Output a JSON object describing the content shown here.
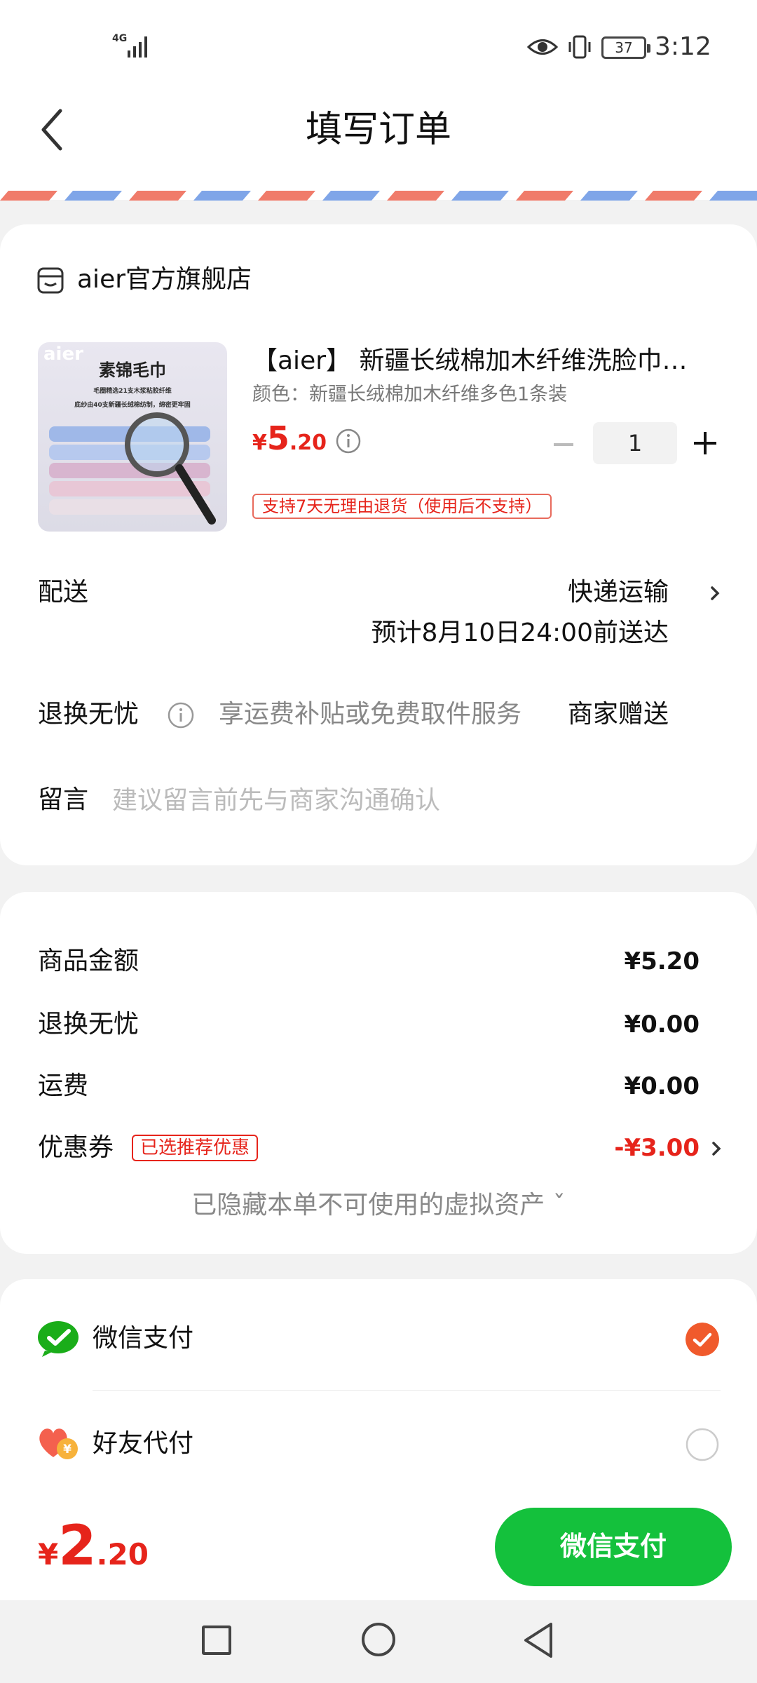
{
  "status_bar": {
    "network": "4G",
    "battery": "37",
    "time": "3:12"
  },
  "header": {
    "title": "填写订单"
  },
  "shop": {
    "name": "aier官方旗舰店"
  },
  "product": {
    "thumb_logo": "aier",
    "thumb_title": "素锦毛巾",
    "thumb_line1": "毛圈精选21支木浆粘胶纤维",
    "thumb_line2": "底纱由40支新疆长绒棉纺制，绵密更牢固",
    "title": "【aier】 新疆长绒棉加木纤维洗脸巾…",
    "spec": "颜色：新疆长绒棉加木纤维多色1条装",
    "price_currency": "¥",
    "price_int": "5",
    "price_dec": ".20",
    "quantity": "1",
    "return_tag": "支持7天无理由退货（使用后不支持）"
  },
  "delivery": {
    "label": "配送",
    "method": "快递运输",
    "eta": "预计8月10日24:00前送达"
  },
  "exchange": {
    "label": "退换无忧",
    "desc": "享运费补贴或免费取件服务",
    "value": "商家赠送"
  },
  "note": {
    "label": "留言",
    "placeholder": "建议留言前先与商家沟通确认"
  },
  "summary": {
    "goods_label": "商品金额",
    "goods_value": "¥5.20",
    "exchange_label": "退换无忧",
    "exchange_value": "¥0.00",
    "shipping_label": "运费",
    "shipping_value": "¥0.00",
    "coupon_label": "优惠券",
    "coupon_tag": "已选推荐优惠",
    "coupon_value": "-¥3.00",
    "hidden_assets": "已隐藏本单不可使用的虚拟资产 ˇ"
  },
  "payment": {
    "options": [
      {
        "label": "微信支付",
        "selected": true
      },
      {
        "label": "好友代付",
        "selected": false
      }
    ]
  },
  "bottom": {
    "total_currency": "¥",
    "total_int": "2",
    "total_dec": ".20",
    "pay_button": "微信支付"
  },
  "colors": {
    "accent_red": "#e6241b",
    "wechat_green": "#14c13c",
    "radio_selected": "#f05a2c"
  }
}
